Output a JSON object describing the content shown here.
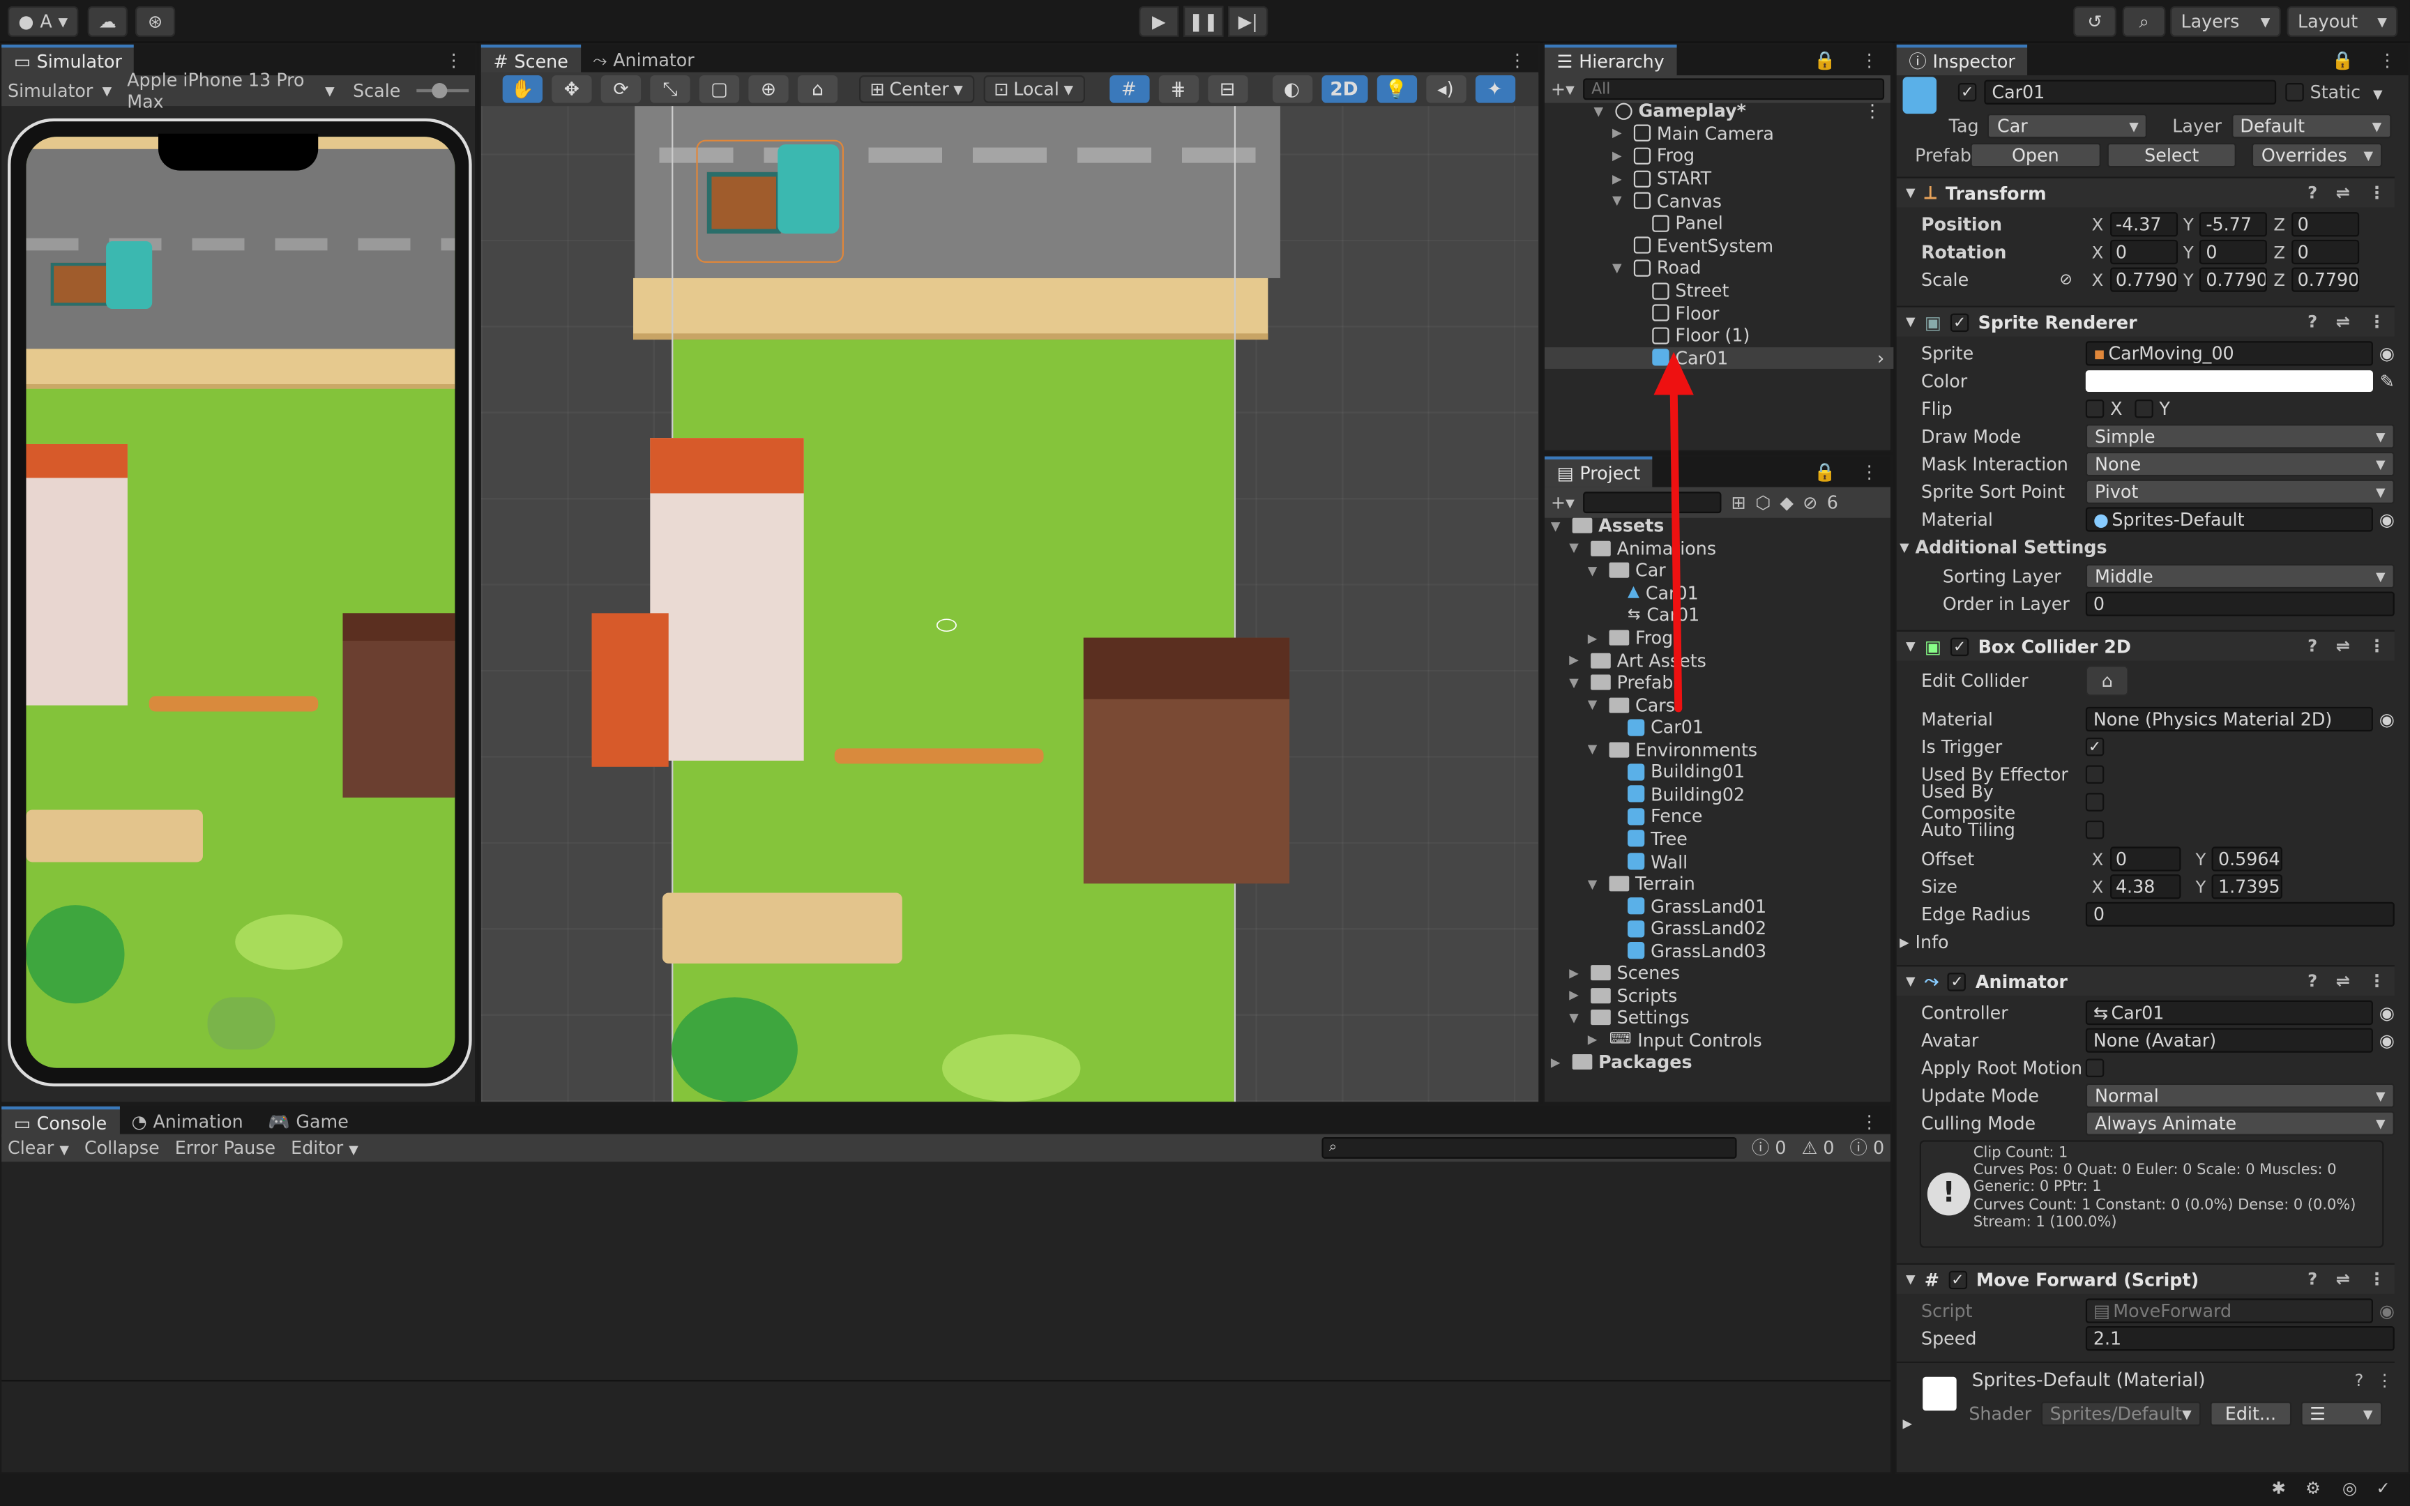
{
  "toolbar": {
    "account": "A",
    "layers": "Layers",
    "layout": "Layout"
  },
  "simulator": {
    "tab": "Simulator",
    "mode": "Simulator",
    "device": "Apple iPhone 13 Pro Max",
    "scale": "Scale"
  },
  "scene": {
    "tab": "Scene",
    "tab2": "Animator",
    "pivot": "Center",
    "space": "Local",
    "mode2d": "2D"
  },
  "hierarchy": {
    "tab": "Hierarchy",
    "search": "All",
    "items": [
      {
        "label": "Gameplay*",
        "depth": 0,
        "open": true,
        "icon": "unity"
      },
      {
        "label": "Main Camera",
        "depth": 1,
        "arrow": true
      },
      {
        "label": "Frog",
        "depth": 1,
        "arrow": true
      },
      {
        "label": "START",
        "depth": 1,
        "arrow": true
      },
      {
        "label": "Canvas",
        "depth": 1,
        "open": true
      },
      {
        "label": "Panel",
        "depth": 2
      },
      {
        "label": "EventSystem",
        "depth": 1
      },
      {
        "label": "Road",
        "depth": 1,
        "open": true
      },
      {
        "label": "Street",
        "depth": 2
      },
      {
        "label": "Floor",
        "depth": 2
      },
      {
        "label": "Floor (1)",
        "depth": 2
      },
      {
        "label": "Car01",
        "depth": 2,
        "selected": true
      }
    ]
  },
  "project": {
    "tab": "Project",
    "count": "6",
    "items": [
      {
        "label": "Assets",
        "depth": 0,
        "open": true,
        "bold": true
      },
      {
        "label": "Animations",
        "depth": 1,
        "open": true
      },
      {
        "label": "Car",
        "depth": 2,
        "open": true
      },
      {
        "label": "Car01",
        "depth": 3,
        "file": "anim"
      },
      {
        "label": "Car01",
        "depth": 3,
        "file": "controller"
      },
      {
        "label": "Frog",
        "depth": 2,
        "arrow": true
      },
      {
        "label": "Art Assets",
        "depth": 1,
        "arrow": true
      },
      {
        "label": "Prefabs",
        "depth": 1,
        "open": true
      },
      {
        "label": "Cars",
        "depth": 2,
        "open": true
      },
      {
        "label": "Car01",
        "depth": 3,
        "file": "prefab"
      },
      {
        "label": "Environments",
        "depth": 2,
        "open": true
      },
      {
        "label": "Building01",
        "depth": 3,
        "file": "prefab"
      },
      {
        "label": "Building02",
        "depth": 3,
        "file": "prefab"
      },
      {
        "label": "Fence",
        "depth": 3,
        "file": "prefab"
      },
      {
        "label": "Tree",
        "depth": 3,
        "file": "prefab"
      },
      {
        "label": "Wall",
        "depth": 3,
        "file": "prefab"
      },
      {
        "label": "Terrain",
        "depth": 2,
        "open": true
      },
      {
        "label": "GrassLand01",
        "depth": 3,
        "file": "prefab"
      },
      {
        "label": "GrassLand02",
        "depth": 3,
        "file": "prefab"
      },
      {
        "label": "GrassLand03",
        "depth": 3,
        "file": "prefab"
      },
      {
        "label": "Scenes",
        "depth": 1,
        "arrow": true
      },
      {
        "label": "Scripts",
        "depth": 1,
        "arrow": true
      },
      {
        "label": "Settings",
        "depth": 1,
        "open": true
      },
      {
        "label": "Input Controls",
        "depth": 2,
        "arrow": true,
        "file": "input"
      },
      {
        "label": "Packages",
        "depth": 0,
        "arrow": true,
        "bold": true
      }
    ]
  },
  "console": {
    "tabs": [
      "Console",
      "Animation",
      "Game"
    ],
    "clear": "Clear",
    "collapse": "Collapse",
    "error_pause": "Error Pause",
    "editor": "Editor",
    "log": "0",
    "warn": "0",
    "err": "0"
  },
  "inspector": {
    "tab": "Inspector",
    "name": "Car01",
    "static": "Static",
    "tag_label": "Tag",
    "tag": "Car",
    "layer_label": "Layer",
    "layer": "Default",
    "prefab": "Prefab",
    "open": "Open",
    "select": "Select",
    "overrides": "Overrides",
    "transform": {
      "title": "Transform",
      "position": "Position",
      "rotation": "Rotation",
      "scale": "Scale",
      "pos": [
        "-4.37",
        "-5.77",
        "0"
      ],
      "rot": [
        "0",
        "0",
        "0"
      ],
      "scl": [
        "0.77903",
        "0.77903",
        "0.77903"
      ]
    },
    "sprite_renderer": {
      "title": "Sprite Renderer",
      "sprite_label": "Sprite",
      "sprite": "CarMoving_00",
      "color": "Color",
      "flip": "Flip",
      "x": "X",
      "y": "Y",
      "draw_mode_label": "Draw Mode",
      "draw_mode": "Simple",
      "mask_label": "Mask Interaction",
      "mask": "None",
      "sort_point_label": "Sprite Sort Point",
      "sort_point": "Pivot",
      "material_label": "Material",
      "material": "Sprites-Default",
      "additional": "Additional Settings",
      "sorting_layer_label": "Sorting Layer",
      "sorting_layer": "Middle",
      "order_label": "Order in Layer",
      "order": "0"
    },
    "box_collider": {
      "title": "Box Collider 2D",
      "edit": "Edit Collider",
      "material_label": "Material",
      "material": "None (Physics Material 2D)",
      "is_trigger": "Is Trigger",
      "by_effector": "Used By Effector",
      "by_composite": "Used By Composite",
      "auto_tiling": "Auto Tiling",
      "offset": "Offset",
      "offset_x": "0",
      "offset_y": "0.59649",
      "size": "Size",
      "size_x": "4.38",
      "size_y": "1.73952",
      "edge_radius": "Edge Radius",
      "edge_val": "0",
      "info": "Info"
    },
    "animator": {
      "title": "Animator",
      "controller_label": "Controller",
      "controller": "Car01",
      "avatar_label": "Avatar",
      "avatar": "None (Avatar)",
      "root_motion": "Apply Root Motion",
      "update_label": "Update Mode",
      "update": "Normal",
      "culling_label": "Culling Mode",
      "culling": "Always Animate",
      "info": "Clip Count: 1\nCurves Pos: 0 Quat: 0 Euler: 0 Scale: 0 Muscles: 0 Generic: 0 PPtr: 1\nCurves Count: 1 Constant: 0 (0.0%) Dense: 0 (0.0%) Stream: 1 (100.0%)"
    },
    "move_forward": {
      "title": "Move Forward (Script)",
      "script_label": "Script",
      "script": "MoveForward",
      "speed_label": "Speed",
      "speed": "2.1"
    },
    "material": {
      "title": "Sprites-Default (Material)",
      "shader_label": "Shader",
      "shader": "Sprites/Default",
      "edit": "Edit..."
    }
  },
  "colors": {
    "accent": "#3a79bb",
    "selection": "#2c5d87",
    "grass": "#83c33a",
    "road": "#7a7a7a",
    "annotation": "#ee1111"
  }
}
